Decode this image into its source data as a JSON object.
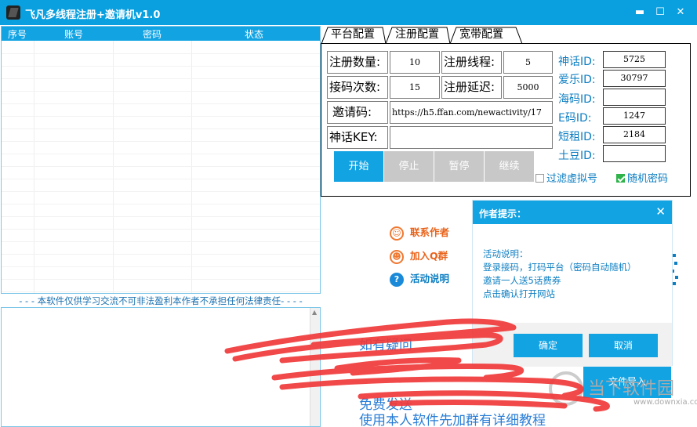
{
  "window": {
    "title": "飞凡多线程注册+邀请机v1.0",
    "buttons": {
      "minimize": "▬",
      "maximize": "☐",
      "close": "✕"
    }
  },
  "table": {
    "columns": [
      "序号",
      "账号",
      "密码",
      "状态"
    ]
  },
  "disclaimer": "- - - 本软件仅供学习交流不可非法盈利本作者不承担任何法律责任- - - -",
  "tabs": [
    "平台配置",
    "注册配置",
    "宽带配置"
  ],
  "form": {
    "reg_count_label": "注册数量:",
    "reg_count_value": "10",
    "reg_threads_label": "注册线程:",
    "reg_threads_value": "5",
    "code_attempts_label": "接码次数:",
    "code_attempts_value": "15",
    "reg_delay_label": "注册延迟:",
    "reg_delay_value": "5000",
    "invite_code_label": "邀请码:",
    "invite_code_value": "https://h5.ffan.com/newactivity/17",
    "shenhua_key_label": "神话KEY:",
    "shenhua_key_value": ""
  },
  "platform_ids": [
    {
      "label": "神话ID:",
      "value": "5725"
    },
    {
      "label": "爱乐ID:",
      "value": "30797"
    },
    {
      "label": "海码ID:",
      "value": ""
    },
    {
      "label": "E码ID:",
      "value": "1247"
    },
    {
      "label": "短租ID:",
      "value": "2184"
    },
    {
      "label": "土豆ID:",
      "value": ""
    }
  ],
  "actions": {
    "start": "开始",
    "stop": "停止",
    "pause": "暂停",
    "resume": "继续"
  },
  "checkboxes": {
    "filter_virtual": {
      "label": "过滤虚拟号",
      "checked": false
    },
    "random_password": {
      "label": "随机密码",
      "checked": true
    }
  },
  "links": {
    "contact_author": "联系作者",
    "join_qq_group": "加入Q群",
    "activity_info": "活动说明"
  },
  "dialog": {
    "title": "作者提示：",
    "close": "✕",
    "lines": [
      "活动说明：",
      "登录接码，打码平台（密码自动随机）",
      "邀请一人送5话费券",
      "点击确认打开网站"
    ],
    "ok": "确定",
    "cancel": "取消"
  },
  "import_button": "文件导入",
  "background_text": [
    "如有疑问",
    "免费发送",
    "使用本人软件先加群有详细教程"
  ],
  "watermark": {
    "text": "当下软件园",
    "sub": "www.downxia.com"
  },
  "colors": {
    "accent": "#12a3e3",
    "link": "#0c7ec2",
    "scribble": "#f03a3a"
  },
  "icons": {
    "contact": "qq-penguin-icon",
    "group": "qq-group-icon",
    "info": "question-icon"
  }
}
